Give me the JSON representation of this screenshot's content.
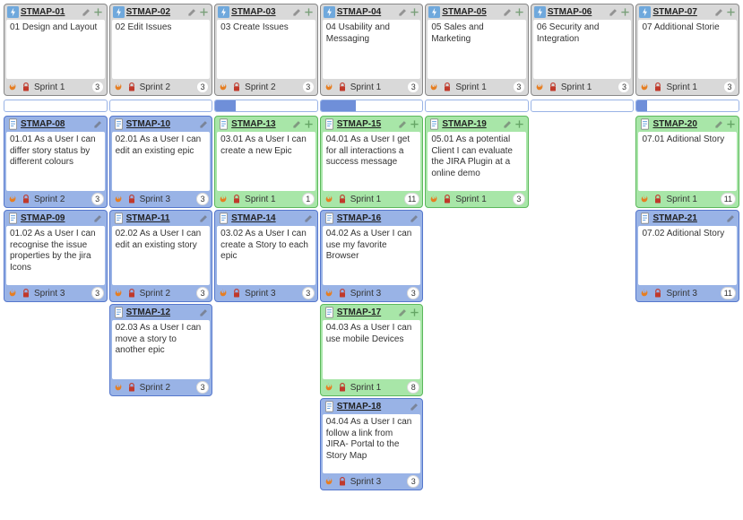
{
  "epics": [
    {
      "id": "STMAP-01",
      "title": "01 Design and Layout",
      "sprint": "Sprint 1",
      "count": 3,
      "color": "gray"
    },
    {
      "id": "STMAP-02",
      "title": "02 Edit Issues",
      "sprint": "Sprint 2",
      "count": 3,
      "color": "gray"
    },
    {
      "id": "STMAP-03",
      "title": "03 Create Issues",
      "sprint": "Sprint 2",
      "count": 3,
      "color": "gray"
    },
    {
      "id": "STMAP-04",
      "title": "04 Usability and Messaging",
      "sprint": "Sprint 1",
      "count": 3,
      "color": "gray"
    },
    {
      "id": "STMAP-05",
      "title": "05 Sales and Marketing",
      "sprint": "Sprint 1",
      "count": 3,
      "color": "gray"
    },
    {
      "id": "STMAP-06",
      "title": "06 Security and Integration",
      "sprint": "Sprint 1",
      "count": 3,
      "color": "gray"
    },
    {
      "id": "STMAP-07",
      "title": "07 Additional Storie",
      "sprint": "Sprint 1",
      "count": 3,
      "color": "gray"
    }
  ],
  "progress": [
    0,
    0,
    20,
    35,
    0,
    0,
    10
  ],
  "stories": [
    [
      {
        "id": "STMAP-08",
        "title": "01.01 As a User I can differ story status by different colours",
        "sprint": "Sprint 2",
        "count": 3,
        "color": "blue"
      },
      {
        "id": "STMAP-10",
        "title": "02.01 As a User I can edit an existing epic",
        "sprint": "Sprint 3",
        "count": 3,
        "color": "blue"
      },
      {
        "id": "STMAP-13",
        "title": "03.01 As a User I can create a new Epic",
        "sprint": "Sprint 1",
        "count": 1,
        "color": "green"
      },
      {
        "id": "STMAP-15",
        "title": "04.01 As a User I get for all interactions a success message",
        "sprint": "Sprint 1",
        "count": 11,
        "color": "green"
      },
      {
        "id": "STMAP-19",
        "title": "05.01 As a potential Client I can evaluate the JIRA Plugin at a online demo",
        "sprint": "Sprint 1",
        "count": 3,
        "color": "green"
      },
      null,
      {
        "id": "STMAP-20",
        "title": "07.01 Aditional Story",
        "sprint": "Sprint 1",
        "count": 11,
        "color": "green"
      }
    ],
    [
      {
        "id": "STMAP-09",
        "title": "01.02 As a User I can recognise the issue properties by the jira Icons",
        "sprint": "Sprint 3",
        "count": 3,
        "color": "blue"
      },
      {
        "id": "STMAP-11",
        "title": "02.02 As a User I can edit an existing story",
        "sprint": "Sprint 2",
        "count": 3,
        "color": "blue"
      },
      {
        "id": "STMAP-14",
        "title": "03.02 As a User I can create a Story to each epic",
        "sprint": "Sprint 3",
        "count": 3,
        "color": "blue"
      },
      {
        "id": "STMAP-16",
        "title": "04.02 As a User I can use my favorite Browser",
        "sprint": "Sprint 3",
        "count": 3,
        "color": "blue"
      },
      null,
      null,
      {
        "id": "STMAP-21",
        "title": "07.02 Aditional Story",
        "sprint": "Sprint 3",
        "count": 11,
        "color": "blue"
      }
    ],
    [
      null,
      {
        "id": "STMAP-12",
        "title": "02.03 As a User I can move a story to another epic",
        "sprint": "Sprint 2",
        "count": 3,
        "color": "blue"
      },
      null,
      {
        "id": "STMAP-17",
        "title": "04.03 As a User I can use mobile Devices",
        "sprint": "Sprint 1",
        "count": 8,
        "color": "green"
      },
      null,
      null,
      null
    ],
    [
      null,
      null,
      null,
      {
        "id": "STMAP-18",
        "title": "04.04 As a User I can follow a link from JIRA- Portal to the Story Map",
        "sprint": "Sprint 3",
        "count": 3,
        "color": "blue"
      },
      null,
      null,
      null
    ]
  ]
}
